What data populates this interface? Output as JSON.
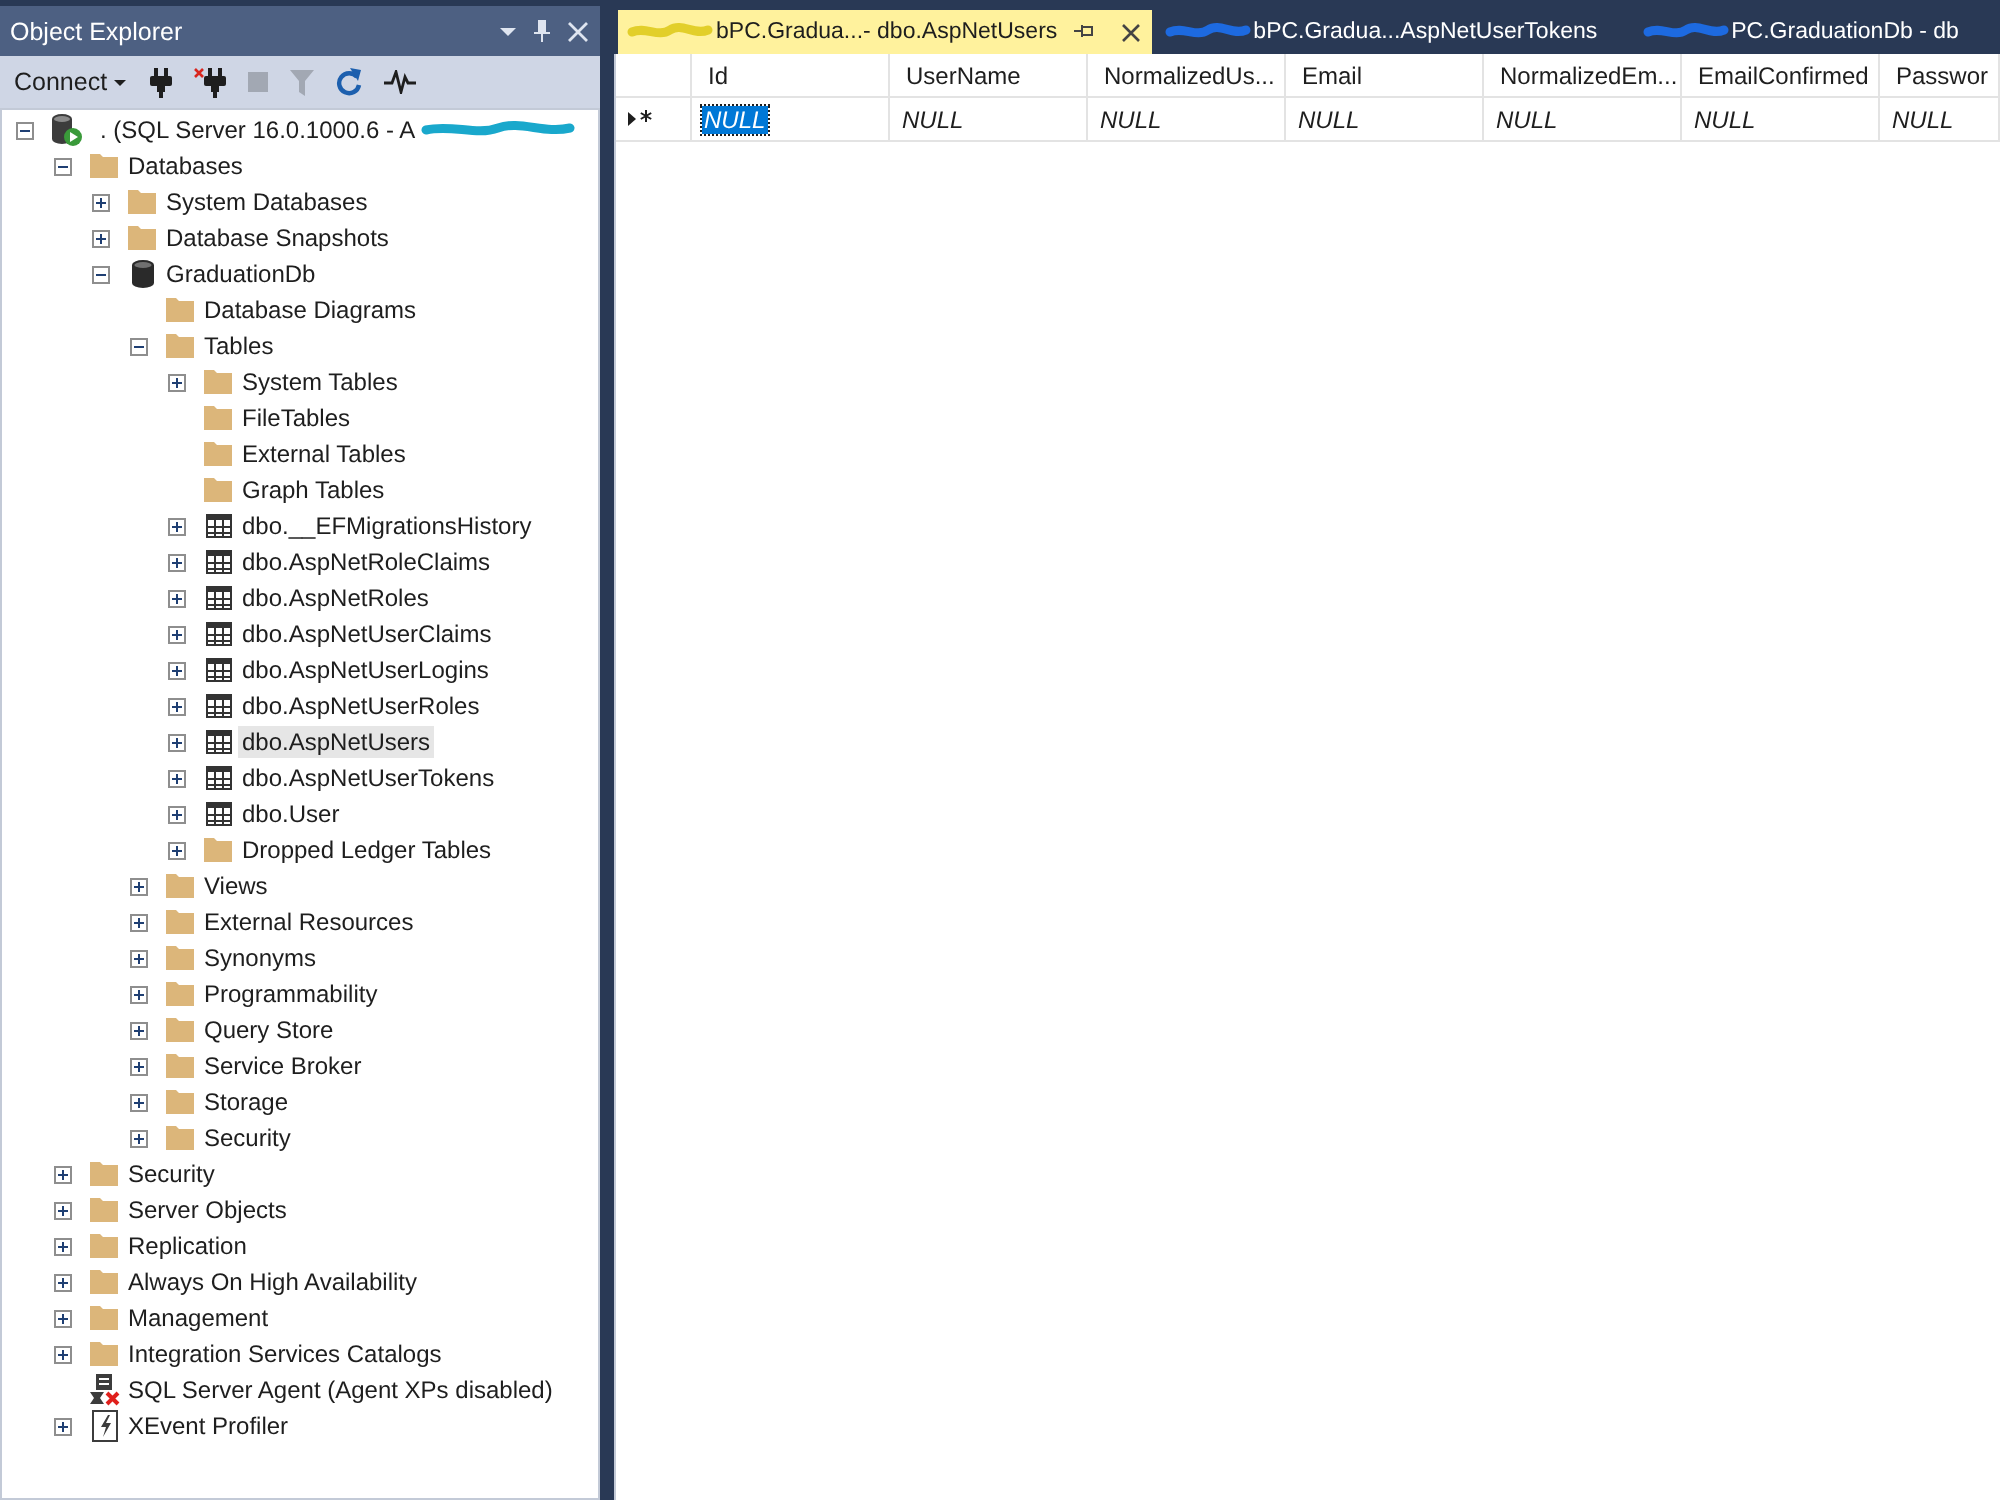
{
  "object_explorer": {
    "title": "Object Explorer",
    "toolbar": {
      "connect_label": "Connect",
      "tools": [
        {
          "kind": "connect",
          "disabled": false
        },
        {
          "kind": "disconnect",
          "disabled": false
        },
        {
          "kind": "stop",
          "disabled": true
        },
        {
          "kind": "filter",
          "disabled": true
        },
        {
          "kind": "refresh",
          "disabled": false
        },
        {
          "kind": "activity",
          "disabled": false
        }
      ]
    },
    "tree": [
      {
        "label": ". (SQL Server 16.0.1000.6 - A",
        "kind": "server",
        "expanded": true,
        "selected": false,
        "redacted": true,
        "children": [
          {
            "label": "Databases",
            "kind": "folder",
            "expanded": true,
            "selected": false,
            "children": [
              {
                "label": "System Databases",
                "kind": "folder",
                "expanded": false,
                "selected": false
              },
              {
                "label": "Database Snapshots",
                "kind": "folder",
                "expanded": false,
                "selected": false
              },
              {
                "label": "GraduationDb",
                "kind": "database",
                "expanded": true,
                "selected": false,
                "children": [
                  {
                    "label": "Database Diagrams",
                    "kind": "folder",
                    "selected": false
                  },
                  {
                    "label": "Tables",
                    "kind": "folder",
                    "expanded": true,
                    "selected": false,
                    "children": [
                      {
                        "label": "System Tables",
                        "kind": "folder",
                        "expanded": false,
                        "selected": false
                      },
                      {
                        "label": "FileTables",
                        "kind": "folder",
                        "selected": false
                      },
                      {
                        "label": "External Tables",
                        "kind": "folder",
                        "selected": false
                      },
                      {
                        "label": "Graph Tables",
                        "kind": "folder",
                        "selected": false
                      },
                      {
                        "label": "dbo.__EFMigrationsHistory",
                        "kind": "table",
                        "expanded": false,
                        "selected": false
                      },
                      {
                        "label": "dbo.AspNetRoleClaims",
                        "kind": "table",
                        "expanded": false,
                        "selected": false
                      },
                      {
                        "label": "dbo.AspNetRoles",
                        "kind": "table",
                        "expanded": false,
                        "selected": false
                      },
                      {
                        "label": "dbo.AspNetUserClaims",
                        "kind": "table",
                        "expanded": false,
                        "selected": false
                      },
                      {
                        "label": "dbo.AspNetUserLogins",
                        "kind": "table",
                        "expanded": false,
                        "selected": false
                      },
                      {
                        "label": "dbo.AspNetUserRoles",
                        "kind": "table",
                        "expanded": false,
                        "selected": false
                      },
                      {
                        "label": "dbo.AspNetUsers",
                        "kind": "table",
                        "expanded": false,
                        "selected": true
                      },
                      {
                        "label": "dbo.AspNetUserTokens",
                        "kind": "table",
                        "expanded": false,
                        "selected": false
                      },
                      {
                        "label": "dbo.User",
                        "kind": "table",
                        "expanded": false,
                        "selected": false
                      },
                      {
                        "label": "Dropped Ledger Tables",
                        "kind": "folder",
                        "expanded": false,
                        "selected": false
                      }
                    ]
                  },
                  {
                    "label": "Views",
                    "kind": "folder",
                    "expanded": false,
                    "selected": false
                  },
                  {
                    "label": "External Resources",
                    "kind": "folder",
                    "expanded": false,
                    "selected": false
                  },
                  {
                    "label": "Synonyms",
                    "kind": "folder",
                    "expanded": false,
                    "selected": false
                  },
                  {
                    "label": "Programmability",
                    "kind": "folder",
                    "expanded": false,
                    "selected": false
                  },
                  {
                    "label": "Query Store",
                    "kind": "folder",
                    "expanded": false,
                    "selected": false
                  },
                  {
                    "label": "Service Broker",
                    "kind": "folder",
                    "expanded": false,
                    "selected": false
                  },
                  {
                    "label": "Storage",
                    "kind": "folder",
                    "expanded": false,
                    "selected": false
                  },
                  {
                    "label": "Security",
                    "kind": "folder",
                    "expanded": false,
                    "selected": false
                  }
                ]
              }
            ]
          },
          {
            "label": "Security",
            "kind": "folder",
            "expanded": false,
            "selected": false
          },
          {
            "label": "Server Objects",
            "kind": "folder",
            "expanded": false,
            "selected": false
          },
          {
            "label": "Replication",
            "kind": "folder",
            "expanded": false,
            "selected": false
          },
          {
            "label": "Always On High Availability",
            "kind": "folder",
            "expanded": false,
            "selected": false
          },
          {
            "label": "Management",
            "kind": "folder",
            "expanded": false,
            "selected": false
          },
          {
            "label": "Integration Services Catalogs",
            "kind": "folder",
            "expanded": false,
            "selected": false
          },
          {
            "label": "SQL Server Agent (Agent XPs disabled)",
            "kind": "agent",
            "selected": false
          },
          {
            "label": "XEvent Profiler",
            "kind": "xevent",
            "expanded": false,
            "selected": false
          }
        ]
      }
    ]
  },
  "tabs": [
    {
      "label": "bPC.Gradua...- dbo.AspNetUsers",
      "selected": true,
      "redacted": true
    },
    {
      "label": "bPC.Gradua...AspNetUserTokens",
      "selected": false,
      "redacted": true
    },
    {
      "label": "PC.GraduationDb - db",
      "selected": false,
      "redacted": true
    }
  ],
  "grid": {
    "columns": [
      "Id",
      "UserName",
      "NormalizedUs...",
      "Email",
      "NormalizedEm...",
      "EmailConfirmed",
      "Passwor"
    ],
    "rows": [
      {
        "current": true,
        "new_row": true,
        "cells": [
          {
            "text": "NULL",
            "selected": true
          },
          {
            "text": "NULL",
            "selected": false
          },
          {
            "text": "NULL",
            "selected": false
          },
          {
            "text": "NULL",
            "selected": false
          },
          {
            "text": "NULL",
            "selected": false
          },
          {
            "text": "NULL",
            "selected": false
          },
          {
            "text": "NULL",
            "selected": false
          }
        ]
      }
    ]
  }
}
